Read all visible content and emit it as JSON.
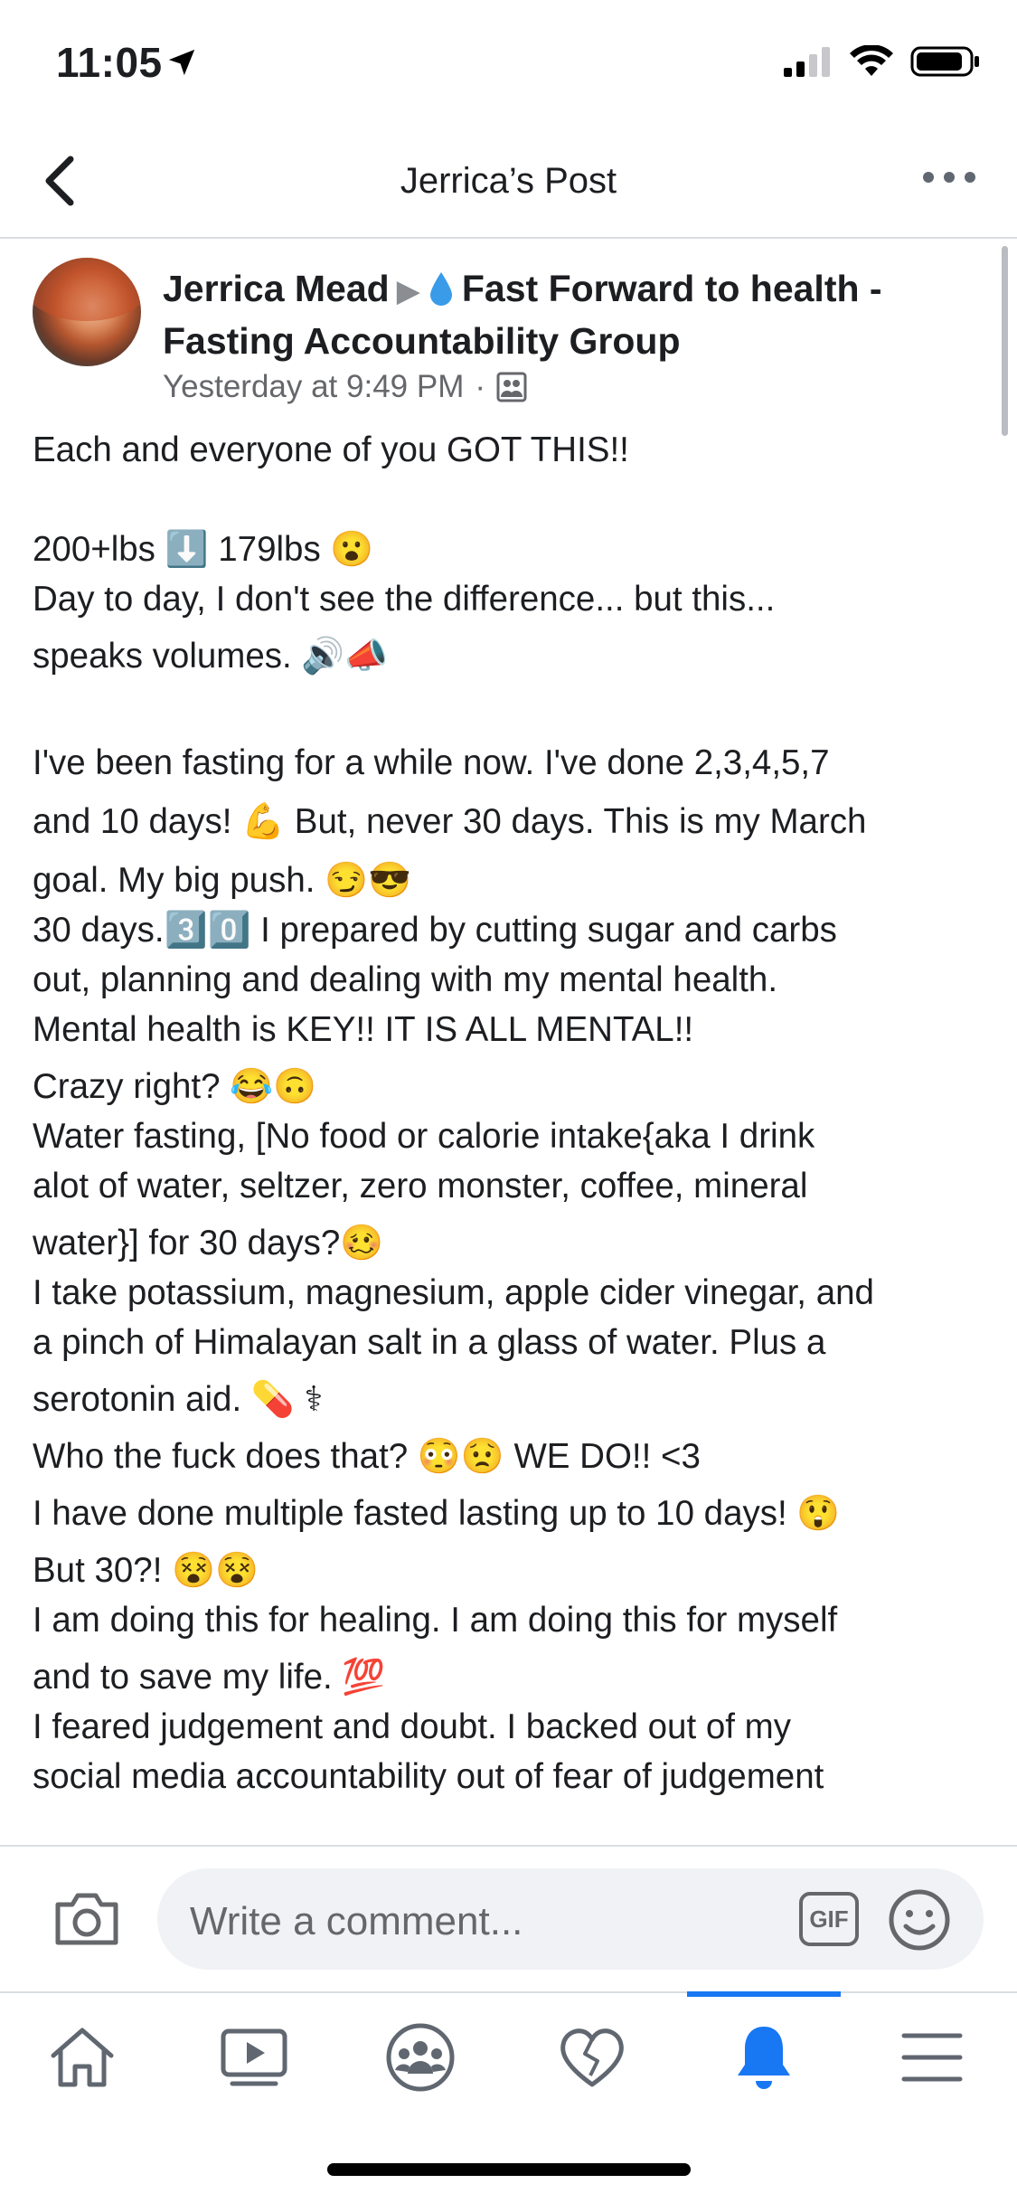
{
  "status_bar": {
    "time": "11:05"
  },
  "nav": {
    "title": "Jerrica’s Post"
  },
  "post": {
    "author": "Jerrica Mead",
    "group": "Fast Forward to health - Fasting Accountability Group",
    "timestamp": "Yesterday at 9:49 PM",
    "separator": "·",
    "lines": [
      "Each and everyone of you GOT THIS!!",
      "",
      "200+lbs ⬇️ 179lbs 😮",
      "Day to day, I don't see the difference... but this...",
      "speaks volumes. 🔊📣",
      "",
      "I've been fasting for a while now. I've done 2,3,4,5,7",
      "and 10 days! 💪 But, never 30 days. This is my March",
      "goal. My big push. 😏😎",
      "30 days.3️⃣0️⃣ I prepared by cutting sugar and carbs",
      "out, planning and dealing with my mental health.",
      "Mental health is KEY!! IT IS ALL MENTAL!!",
      "Crazy right? 😂🙃",
      "Water fasting, [No food or calorie intake{aka I drink",
      "alot of water, seltzer, zero monster, coffee, mineral",
      "water}] for 30 days?🥴",
      "I take potassium, magnesium, apple cider vinegar, and",
      "a pinch of Himalayan salt in a glass of water. Plus a",
      "serotonin aid. 💊 ⚕",
      "Who the fuck does that? 😳😟 WE DO!! <3",
      "I have done multiple fasted lasting up to 10 days! 😲",
      "But 30?! 😵😵",
      "I am doing this for healing. I am doing this for myself",
      "and to save my life. 💯",
      "I feared judgement and doubt. I backed out of my",
      "social media accountability out of fear of judgement"
    ]
  },
  "comment": {
    "placeholder": "Write a comment...",
    "gif_label": "GIF"
  },
  "tabs": [
    {
      "icon": "home-icon",
      "active": false
    },
    {
      "icon": "video-icon",
      "active": false
    },
    {
      "icon": "groups-icon",
      "active": false
    },
    {
      "icon": "dating-heart-icon",
      "active": false
    },
    {
      "icon": "notifications-bell-icon",
      "active": true
    },
    {
      "icon": "menu-icon",
      "active": false
    }
  ],
  "colors": {
    "accent": "#1877f2",
    "secondary_text": "#65676b",
    "text": "#1c1e21"
  }
}
